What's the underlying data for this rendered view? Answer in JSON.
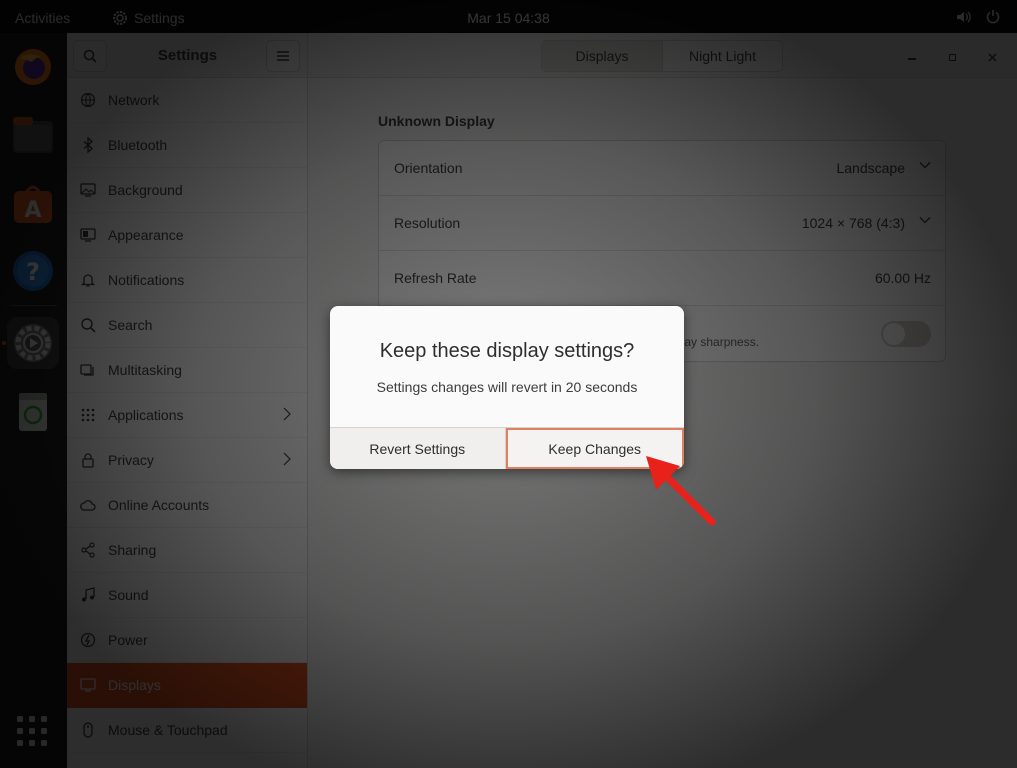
{
  "topbar": {
    "activities": "Activities",
    "app_name": "Settings",
    "clock": "Mar 15  04:38"
  },
  "dock": {
    "items": [
      "firefox-icon",
      "files-icon",
      "software-icon",
      "help-icon",
      "settings-icon",
      "trash-icon"
    ]
  },
  "headerbar": {
    "title": "Settings",
    "tabs": [
      {
        "label": "Displays"
      },
      {
        "label": "Night Light"
      }
    ]
  },
  "sidebar": {
    "items": [
      {
        "label": "Network",
        "icon": "network-icon"
      },
      {
        "label": "Bluetooth",
        "icon": "bluetooth-icon"
      },
      {
        "label": "Background",
        "icon": "background-icon"
      },
      {
        "label": "Appearance",
        "icon": "appearance-icon"
      },
      {
        "label": "Notifications",
        "icon": "bell-icon"
      },
      {
        "label": "Search",
        "icon": "search-icon"
      },
      {
        "label": "Multitasking",
        "icon": "multitasking-icon"
      },
      {
        "label": "Applications",
        "icon": "grid-icon"
      },
      {
        "label": "Privacy",
        "icon": "lock-icon"
      },
      {
        "label": "Online Accounts",
        "icon": "cloud-icon"
      },
      {
        "label": "Sharing",
        "icon": "share-icon"
      },
      {
        "label": "Sound",
        "icon": "music-note-icon"
      },
      {
        "label": "Power",
        "icon": "power-icon"
      },
      {
        "label": "Displays",
        "icon": "display-icon"
      },
      {
        "label": "Mouse & Touchpad",
        "icon": "mouse-icon"
      }
    ],
    "selected": "Displays"
  },
  "display": {
    "section_title": "Unknown Display",
    "orientation": {
      "label": "Orientation",
      "value": "Landscape"
    },
    "resolution": {
      "label": "Resolution",
      "value": "1024 × 768 (4:3)"
    },
    "refresh": {
      "label": "Refresh Rate",
      "value": "60.00 Hz"
    },
    "scaling_hint": "splay sharpness."
  },
  "dialog": {
    "title": "Keep these display settings?",
    "message": "Settings changes will revert in 20 seconds",
    "revert_label": "Revert Settings",
    "keep_label": "Keep Changes"
  },
  "colors": {
    "accent": "#e95420",
    "annotation_arrow": "#e8221b"
  }
}
